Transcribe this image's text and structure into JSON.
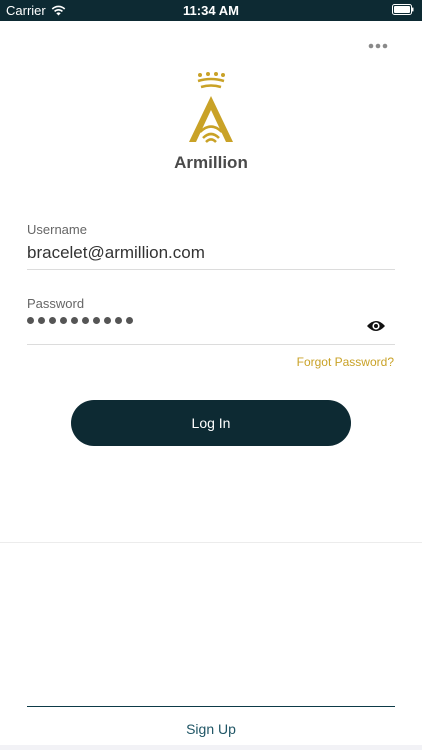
{
  "status_bar": {
    "carrier": "Carrier",
    "time": "11:34 AM"
  },
  "brand": {
    "name": "Armillion",
    "accent_color": "#c9a227",
    "logo_icon": "armillion-logo-icon"
  },
  "header": {
    "more_icon": "more-dots-icon"
  },
  "login_form": {
    "username_label": "Username",
    "username_value": "bracelet@armillion.com",
    "password_label": "Password",
    "password_masked_length": 10,
    "eye_icon": "eye-icon",
    "forgot_password_label": "Forgot Password?",
    "login_label": "Log In"
  },
  "footer": {
    "signup_label": "Sign Up"
  },
  "colors": {
    "primary_dark": "#0d2a33",
    "link_gold": "#c9a227",
    "signup_text": "#1f5565"
  }
}
